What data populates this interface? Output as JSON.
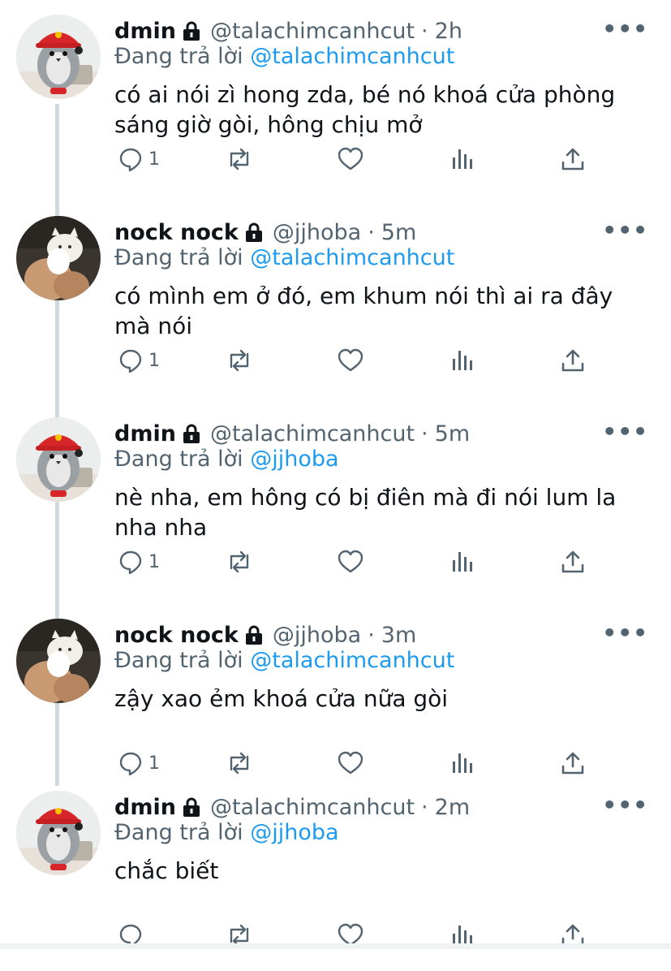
{
  "tweets": [
    {
      "name": "dmin",
      "handle": "@talachimcanhcut",
      "dot": "·",
      "time": "2h",
      "reply_prefix": "Đang trả lời",
      "reply_to": "@talachimcanhcut",
      "text": "có ai nói zì hong zda, bé nó khoá cửa phòng sáng giờ gòi, hông chịu mở",
      "reply_count": "1",
      "avatar": "penguin-avatar"
    },
    {
      "name": "nock nock",
      "handle": "@jjhoba",
      "dot": "·",
      "time": "5m",
      "reply_prefix": "Đang trả lời",
      "reply_to": "@talachimcanhcut",
      "text": "có mình em ở đó, em khum nói thì ai ra đây mà nói",
      "reply_count": "1",
      "avatar": "cat-avatar"
    },
    {
      "name": "dmin",
      "handle": "@talachimcanhcut",
      "dot": "·",
      "time": "5m",
      "reply_prefix": "Đang trả lời",
      "reply_to": "@jjhoba",
      "text": "nè nha, em hông có bị điên mà đi nói lum la nha nha",
      "reply_count": "1",
      "avatar": "penguin-avatar"
    },
    {
      "name": "nock nock",
      "handle": "@jjhoba",
      "dot": "·",
      "time": "3m",
      "reply_prefix": "Đang trả lời",
      "reply_to": "@talachimcanhcut",
      "text": "zậy xao ẻm khoá cửa nữa gòi",
      "reply_count": "1",
      "avatar": "cat-avatar"
    },
    {
      "name": "dmin",
      "handle": "@talachimcanhcut",
      "dot": "·",
      "time": "2m",
      "reply_prefix": "Đang trả lời",
      "reply_to": "@jjhoba",
      "text": "chắc biết",
      "reply_count": "",
      "avatar": "penguin-avatar"
    }
  ],
  "more_label": "•••",
  "colors": {
    "text": "#0f1419",
    "secondary": "#536471",
    "mention": "#1d9bf0",
    "thread_line": "#cfd9de"
  }
}
